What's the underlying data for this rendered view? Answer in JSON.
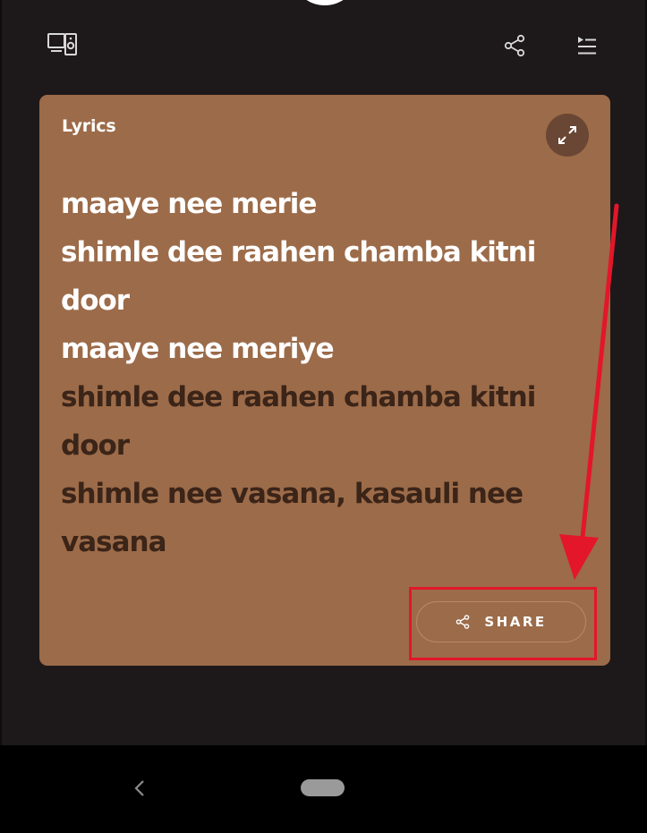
{
  "header": {
    "devices_icon": "devices-icon",
    "share_icon": "share-icon",
    "queue_icon": "queue-icon"
  },
  "lyrics_card": {
    "title": "Lyrics",
    "background": "#9c6b49",
    "expand_icon": "expand-icon",
    "lines": [
      {
        "text": "maaye nee merie",
        "state": "sung"
      },
      {
        "text": "shimle dee raahen chamba kitni door",
        "state": "sung"
      },
      {
        "text": "maaye nee meriye",
        "state": "sung"
      },
      {
        "text": "shimle dee raahen chamba kitni door",
        "state": "upcoming"
      },
      {
        "text": "shimle nee vasana, kasauli nee vasana",
        "state": "upcoming"
      }
    ],
    "share_button": {
      "label": "SHARE",
      "icon": "share-icon"
    }
  },
  "annotation": {
    "color": "#e3162a"
  },
  "system_nav": {
    "back_icon": "back-chevron-icon",
    "home_icon": "home-pill-icon"
  }
}
